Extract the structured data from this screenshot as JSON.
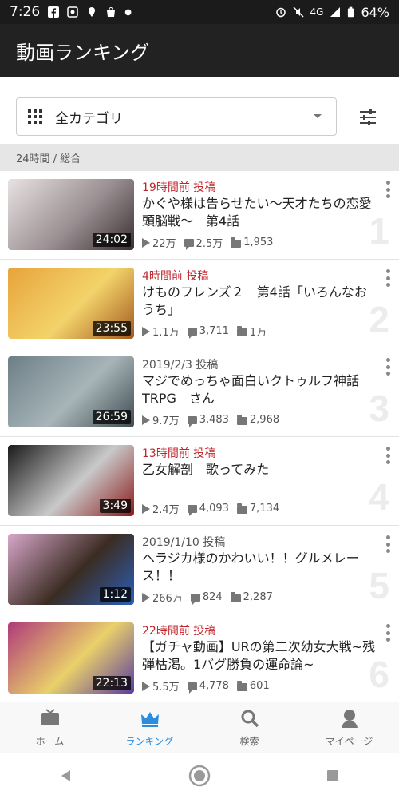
{
  "status_bar": {
    "time": "7:26",
    "network": "4G",
    "battery": "64%",
    "icons_left": [
      "facebook-icon",
      "app-icon",
      "location-icon",
      "bag-icon",
      "dot-icon"
    ],
    "icons_right": [
      "alarm-icon",
      "mute-icon",
      "signal-icon",
      "battery-icon"
    ]
  },
  "header": {
    "title": "動画ランキング"
  },
  "category": {
    "selected": "全カテゴリ"
  },
  "section": {
    "label": "24時間 / 総合"
  },
  "items": [
    {
      "rank": "1",
      "posted": "19時間前 投稿",
      "recent": true,
      "title": "かぐや様は告らせたい〜天才たちの恋愛頭脳戦〜　第4話",
      "duration": "24:02",
      "views": "22万",
      "comments": "2.5万",
      "mylists": "1,953",
      "thumb": [
        "#e8e2e2",
        "#9a8f92",
        "#3a2f30"
      ]
    },
    {
      "rank": "2",
      "posted": "4時間前 投稿",
      "recent": true,
      "title": "けものフレンズ２　第4話「いろんなおうち」",
      "duration": "23:55",
      "views": "1.1万",
      "comments": "3,711",
      "mylists": "1万",
      "thumb": [
        "#e7a43a",
        "#f3d36b",
        "#a35a1e"
      ]
    },
    {
      "rank": "3",
      "posted": "2019/2/3  投稿",
      "recent": false,
      "title": "マジでめっちゃ面白いクトゥルフ神話TRPG　さん",
      "duration": "26:59",
      "views": "9.7万",
      "comments": "3,483",
      "mylists": "2,968",
      "thumb": [
        "#6d7f86",
        "#a7b5b9",
        "#3e4b50"
      ]
    },
    {
      "rank": "4",
      "posted": "13時間前 投稿",
      "recent": true,
      "title": "乙女解剖　歌ってみた",
      "duration": "3:49",
      "views": "2.4万",
      "comments": "4,093",
      "mylists": "7,134",
      "thumb": [
        "#1a1a1a",
        "#c9c9c9",
        "#8b1b1b"
      ]
    },
    {
      "rank": "5",
      "posted": "2019/1/10  投稿",
      "recent": false,
      "title": "ヘラジカ様のかわいい！！グルメレース！！",
      "duration": "1:12",
      "views": "266万",
      "comments": "824",
      "mylists": "2,287",
      "thumb": [
        "#d7a7c9",
        "#3b2c22",
        "#2c5fb8"
      ]
    },
    {
      "rank": "6",
      "posted": "22時間前 投稿",
      "recent": true,
      "title": "【ガチャ動画】URの第二次幼女大戦~残弾枯渇。1バグ勝負の運命論~",
      "duration": "22:13",
      "views": "5.5万",
      "comments": "4,778",
      "mylists": "601",
      "thumb": [
        "#b03a7a",
        "#e9d06a",
        "#5a3c9e"
      ]
    }
  ],
  "bottom_nav": [
    {
      "label": "ホーム",
      "icon": "tv-icon",
      "active": false
    },
    {
      "label": "ランキング",
      "icon": "crown-icon",
      "active": true
    },
    {
      "label": "検索",
      "icon": "search-icon",
      "active": false
    },
    {
      "label": "マイページ",
      "icon": "person-icon",
      "active": false
    }
  ],
  "colors": {
    "accent_red": "#c0272d",
    "active_blue": "#2a8ee0",
    "header_bg": "#222222"
  }
}
